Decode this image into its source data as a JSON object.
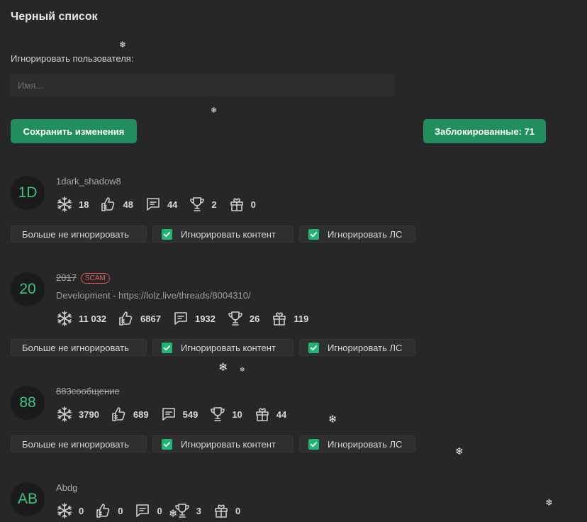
{
  "title": "Черный список",
  "ignore": {
    "label": "Игнорировать пользователя:",
    "placeholder": "Имя..."
  },
  "buttons": {
    "save": "Сохранить изменения",
    "blocked": "Заблокированные: 71"
  },
  "actions": {
    "unignore": "Больше не игнорировать",
    "ignore_content": "Игнорировать контент",
    "ignore_ls": "Игнорировать ЛС"
  },
  "icons": [
    "snowflake-icon",
    "like-hand-icon",
    "message-icon",
    "trophy-icon",
    "gift-icon"
  ],
  "colors": {
    "accent": "#228e5d",
    "checkbox": "#1fb573",
    "avatar_text": "#3cc37f",
    "scam": "#e16360"
  },
  "users": [
    {
      "avatar": "1D",
      "name": "1dark_shadow8",
      "strike": false,
      "scam": "",
      "desc": "",
      "stats": [
        "18",
        "48",
        "44",
        "2",
        "0"
      ]
    },
    {
      "avatar": "20",
      "name": "2017",
      "strike": true,
      "scam": "SCAM",
      "desc": "Development - https://lolz.live/threads/8004310/",
      "stats": [
        "11 032",
        "6867",
        "1932",
        "26",
        "119"
      ]
    },
    {
      "avatar": "88",
      "name": "883сообщение",
      "strike": true,
      "scam": "",
      "desc": "",
      "stats": [
        "3790",
        "689",
        "549",
        "10",
        "44"
      ]
    },
    {
      "avatar": "AB",
      "name": "Abdg",
      "strike": false,
      "scam": "",
      "desc": "",
      "stats": [
        "0",
        "0",
        "0",
        "3",
        "0"
      ]
    }
  ],
  "decor": {
    "snow_glyph": "❄"
  }
}
